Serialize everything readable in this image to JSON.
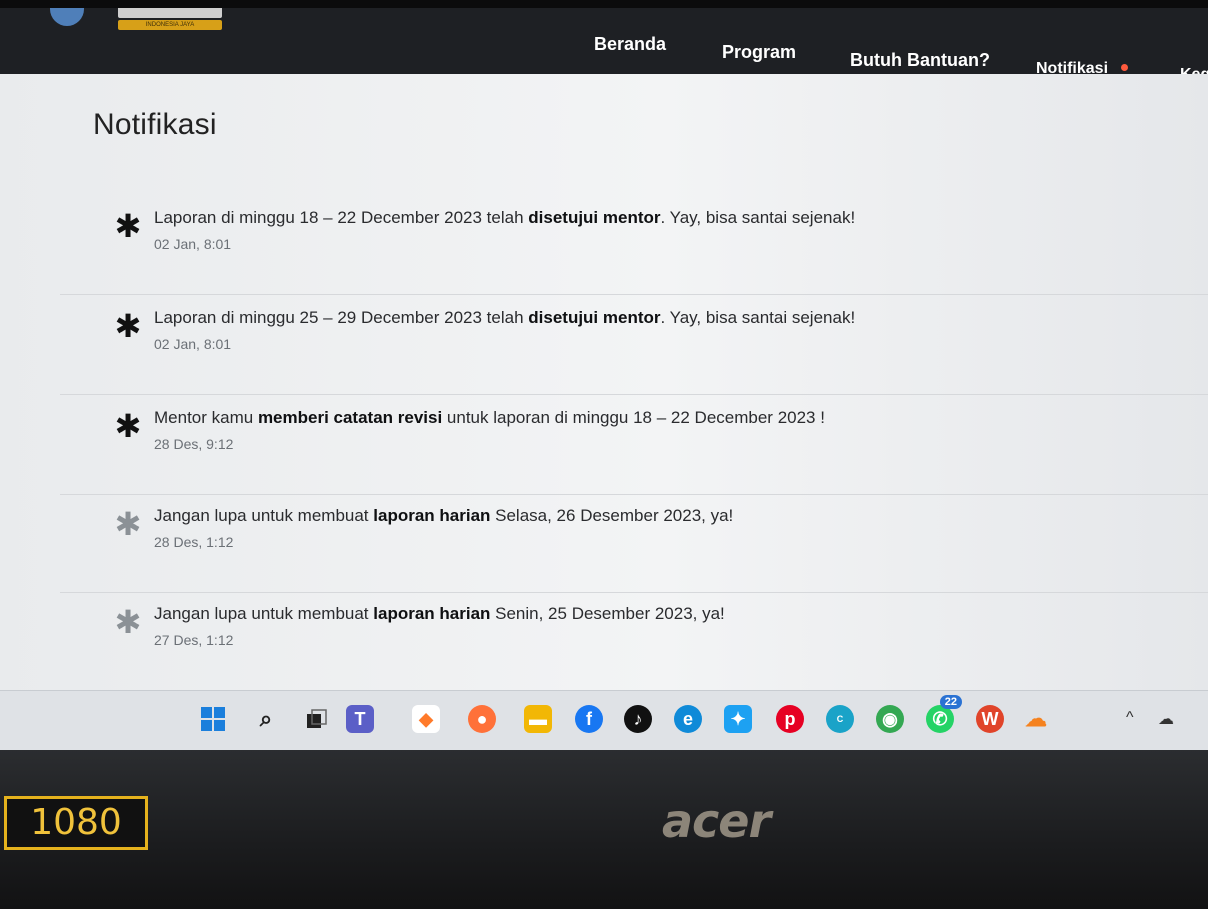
{
  "brand": {
    "sub": "INDONESIA JAYA"
  },
  "nav": {
    "items": [
      "Beranda",
      "Program",
      "Butuh Bantuan?",
      "Notifikasi",
      "Keg"
    ]
  },
  "page": {
    "title": "Notifikasi"
  },
  "notifications": [
    {
      "pre": "Laporan di minggu 18 – 22 December 2023 telah ",
      "bold": "disetujui mentor",
      "post": ". Yay, bisa santai sejenak!",
      "time": "02 Jan, 8:01",
      "icon": "asterisk-icon",
      "read": false
    },
    {
      "pre": "Laporan di minggu 25 – 29 December 2023 telah ",
      "bold": "disetujui mentor",
      "post": ". Yay, bisa santai sejenak!",
      "time": "02 Jan, 8:01",
      "icon": "asterisk-icon",
      "read": false
    },
    {
      "pre": "Mentor kamu ",
      "bold": "memberi catatan revisi",
      "post": " untuk laporan di minggu 18 – 22 December 2023 !",
      "time": "28 Des, 9:12",
      "icon": "asterisk-icon",
      "read": false
    },
    {
      "pre": "Jangan lupa untuk membuat ",
      "bold": "laporan harian",
      "post": " Selasa, 26 Desember 2023, ya!",
      "time": "28 Des, 1:12",
      "icon": "asterisk-icon",
      "read": true
    },
    {
      "pre": "Jangan lupa untuk membuat ",
      "bold": "laporan harian",
      "post": " Senin, 25 Desember 2023, ya!",
      "time": "27 Des, 1:12",
      "icon": "asterisk-icon",
      "read": true
    }
  ],
  "taskbar": {
    "whatsapp_badge": "22"
  },
  "laptop": {
    "sticker": "1080",
    "logo": "acer"
  },
  "colors": {
    "nav_bg": "#1e2024",
    "content_bg": "#eef0f2",
    "notif_dot": "#ff5a3d",
    "sticker": "#e5b21d"
  }
}
